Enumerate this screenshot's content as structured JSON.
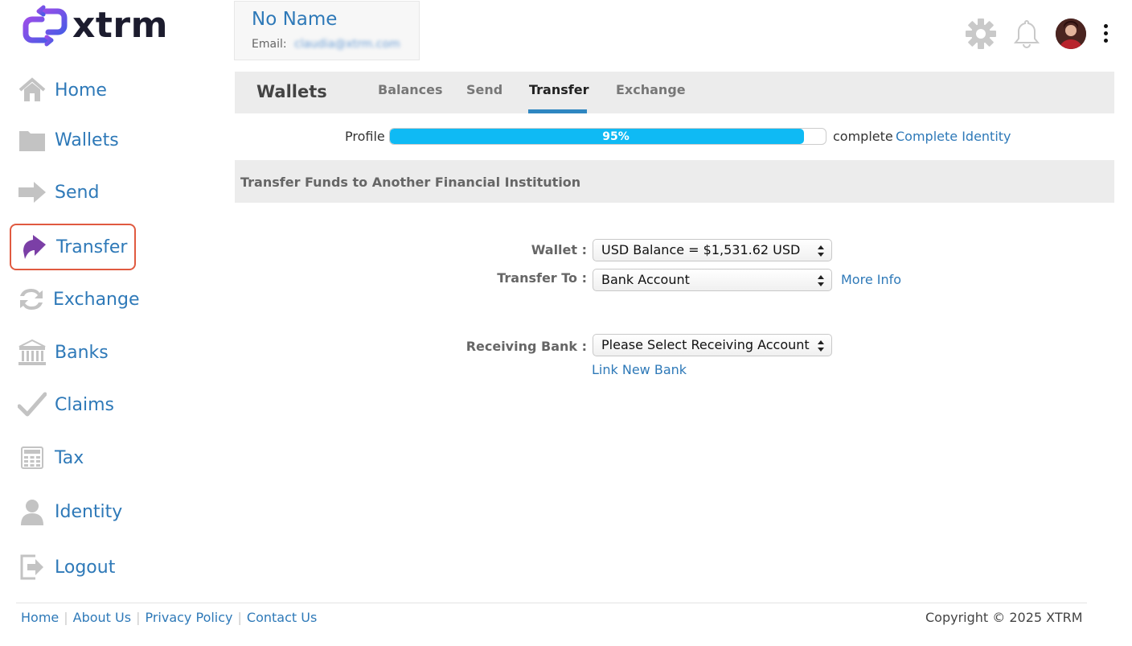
{
  "brand": {
    "name": "xtrm",
    "accent": "#7b4ae0"
  },
  "user": {
    "name": "No Name",
    "email_label": "Email:",
    "email_value": "claudia@xtrm.com"
  },
  "header_icons": [
    "gear-icon",
    "bell-icon",
    "avatar",
    "kebab-menu-icon"
  ],
  "sidebar": {
    "items": [
      {
        "label": "Home",
        "icon": "home-icon"
      },
      {
        "label": "Wallets",
        "icon": "folder-icon"
      },
      {
        "label": "Send",
        "icon": "arrow-right-icon"
      },
      {
        "label": "Transfer",
        "icon": "transfer-arrow-icon",
        "active": true
      },
      {
        "label": "Exchange",
        "icon": "exchange-icon"
      },
      {
        "label": "Banks",
        "icon": "bank-icon"
      },
      {
        "label": "Claims",
        "icon": "checkmark-icon"
      },
      {
        "label": "Tax",
        "icon": "calculator-icon"
      },
      {
        "label": "Identity",
        "icon": "person-icon"
      },
      {
        "label": "Logout",
        "icon": "logout-icon"
      }
    ]
  },
  "tabbar": {
    "title": "Wallets",
    "tabs": [
      {
        "label": "Balances"
      },
      {
        "label": "Send"
      },
      {
        "label": "Transfer",
        "active": true
      },
      {
        "label": "Exchange"
      }
    ]
  },
  "profile": {
    "label": "Profile",
    "percent": 95,
    "percent_text": "95%",
    "complete_text": "complete",
    "link": "Complete Identity"
  },
  "section": {
    "title": "Transfer Funds to Another Financial Institution"
  },
  "form": {
    "wallet_label": "Wallet :",
    "wallet_value": "USD Balance = $1,531.62 USD",
    "transfer_to_label": "Transfer To :",
    "transfer_to_value": "Bank Account",
    "more_info": "More Info",
    "receiving_bank_label": "Receiving Bank :",
    "receiving_bank_value": "Please Select Receiving Account",
    "link_new_bank": "Link New Bank"
  },
  "footer": {
    "links": [
      "Home",
      "About Us",
      "Privacy Policy",
      "Contact Us"
    ],
    "copyright": "Copyright © 2025 XTRM"
  }
}
